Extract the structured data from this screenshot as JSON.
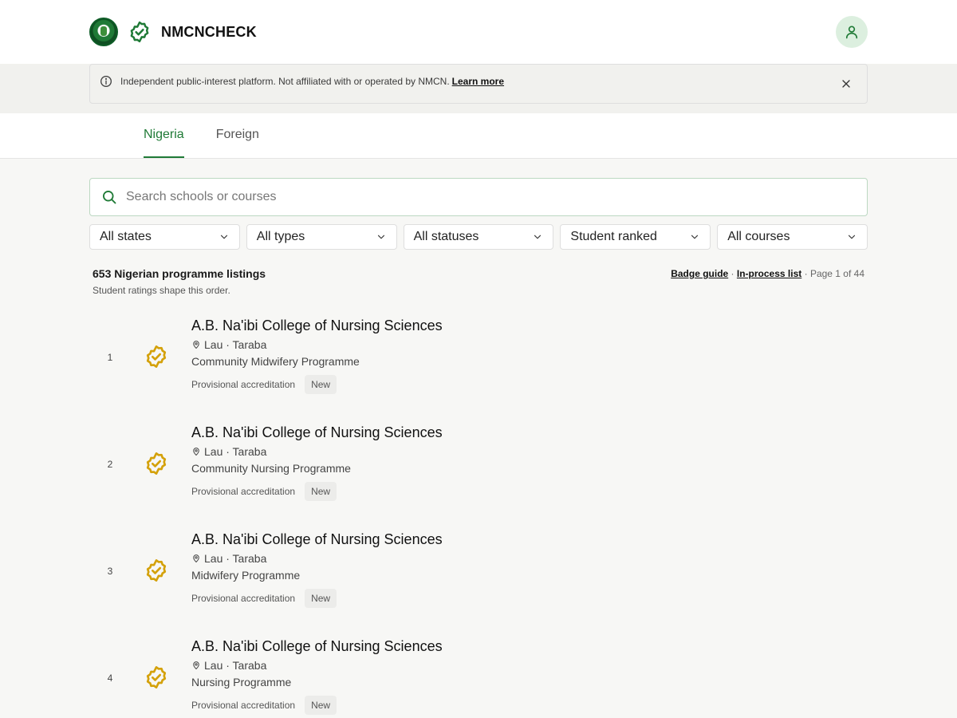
{
  "brand": {
    "name": "NMCNCHECK",
    "accent": "#1f7a36"
  },
  "notice": {
    "text": "Independent public-interest platform. Not affiliated with or operated by NMCN.",
    "link": "Learn more"
  },
  "tabs": [
    {
      "label": "Nigeria",
      "active": true
    },
    {
      "label": "Foreign",
      "active": false
    }
  ],
  "search": {
    "placeholder": "Search schools or courses",
    "value": ""
  },
  "filters": [
    {
      "label": "All states"
    },
    {
      "label": "All types"
    },
    {
      "label": "All statuses"
    },
    {
      "label": "Student ranked"
    },
    {
      "label": "All courses"
    }
  ],
  "results": {
    "count_label": "653 Nigerian programme listings",
    "note": "Student ratings shape this order.",
    "badge_guide": "Badge guide",
    "separator": "·",
    "in_process": "In-process list",
    "page_info": "Page 1 of 44"
  },
  "badge_color": "#d4a10a",
  "listings": [
    {
      "rank": "1",
      "name": "A.B. Na'ibi College of Nursing Sciences",
      "location": "Lau · Taraba",
      "programme": "Community Midwifery Programme",
      "status": "Provisional accreditation",
      "tag": "New"
    },
    {
      "rank": "2",
      "name": "A.B. Na'ibi College of Nursing Sciences",
      "location": "Lau · Taraba",
      "programme": "Community Nursing Programme",
      "status": "Provisional accreditation",
      "tag": "New"
    },
    {
      "rank": "3",
      "name": "A.B. Na'ibi College of Nursing Sciences",
      "location": "Lau · Taraba",
      "programme": "Midwifery Programme",
      "status": "Provisional accreditation",
      "tag": "New"
    },
    {
      "rank": "4",
      "name": "A.B. Na'ibi College of Nursing Sciences",
      "location": "Lau · Taraba",
      "programme": "Nursing Programme",
      "status": "Provisional accreditation",
      "tag": "New"
    }
  ]
}
